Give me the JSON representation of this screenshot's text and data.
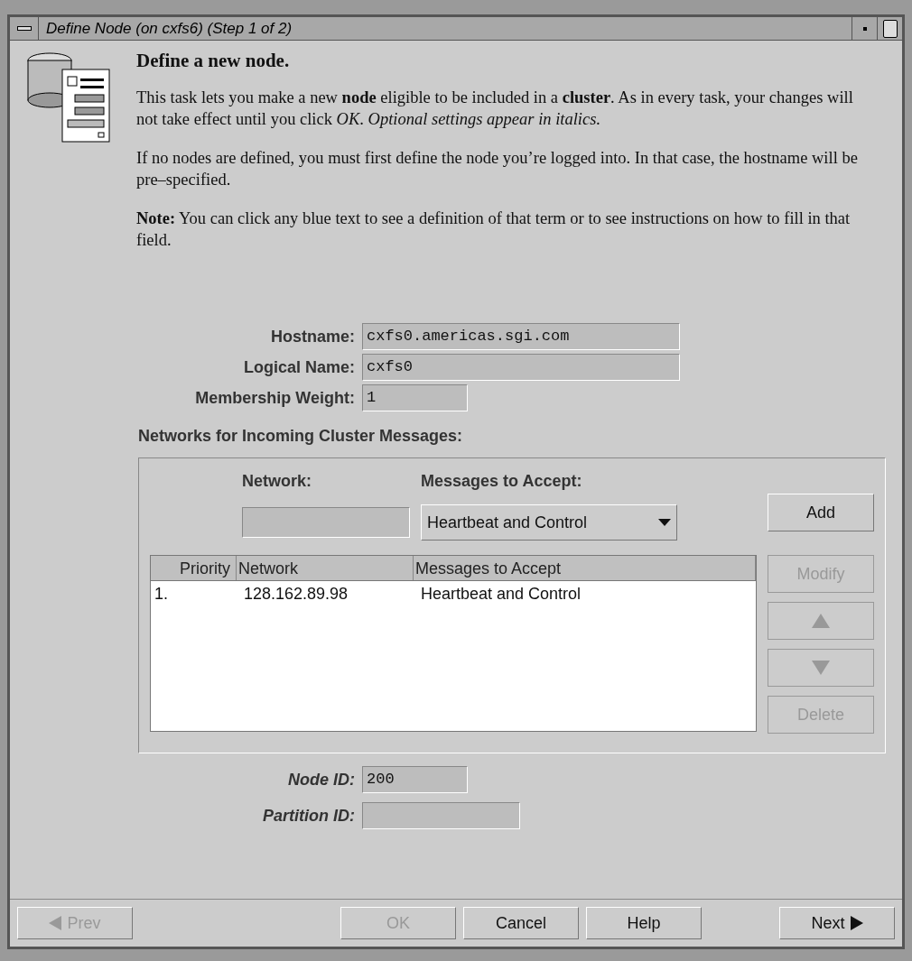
{
  "window": {
    "title": "Define Node (on cxfs6) (Step 1 of 2)"
  },
  "intro": {
    "heading": "Define a new node.",
    "paragraphs": [
      "This task lets you make a new **node** eligible to be included in a **cluster**. As in every task, your changes will not take effect until you click *OK*.  *Optional settings appear in italics.*",
      "If no nodes are defined, you must first define the node you’re logged into.  In that case, the hostname will be pre–specified.",
      "**Note:** You can click any blue text to see a definition of that term or to see instructions on how to fill in that field."
    ]
  },
  "fields": [
    {
      "label": "Hostname:",
      "value": "cxfs0.americas.sgi.com",
      "optional": false
    },
    {
      "label": "Logical Name:",
      "value": "cxfs0",
      "optional": false
    },
    {
      "label": "Membership Weight:",
      "value": "1",
      "optional": false
    }
  ],
  "networks": {
    "heading": "Networks for Incoming Cluster Messages:",
    "network_label": "Network:",
    "messages_label": "Messages to Accept:",
    "messages_value": "Heartbeat and Control",
    "buttons": [
      {
        "kind": "text",
        "label": "Add",
        "disabled": false
      },
      {
        "kind": "text",
        "label": "Modify",
        "disabled": true
      },
      {
        "kind": "up",
        "disabled": true
      },
      {
        "kind": "down",
        "disabled": true
      },
      {
        "kind": "text",
        "label": "Delete",
        "disabled": true
      }
    ],
    "table": {
      "columns": [
        "Priority",
        "Network",
        "Messages to Accept"
      ],
      "rows": [
        [
          "1.",
          "128.162.89.98",
          "Heartbeat and Control"
        ]
      ]
    }
  },
  "optional_fields": [
    {
      "label": "Node ID:",
      "value": "200",
      "optional": true
    },
    {
      "label": "Partition ID:",
      "optional": true
    }
  ],
  "footer": [
    {
      "label": "Prev",
      "kind": "prev",
      "disabled": true
    },
    {
      "label": "OK",
      "disabled": true
    },
    {
      "label": "Cancel",
      "disabled": false
    },
    {
      "label": "Help",
      "disabled": false
    },
    {
      "label": "Next",
      "kind": "next",
      "disabled": false
    }
  ]
}
